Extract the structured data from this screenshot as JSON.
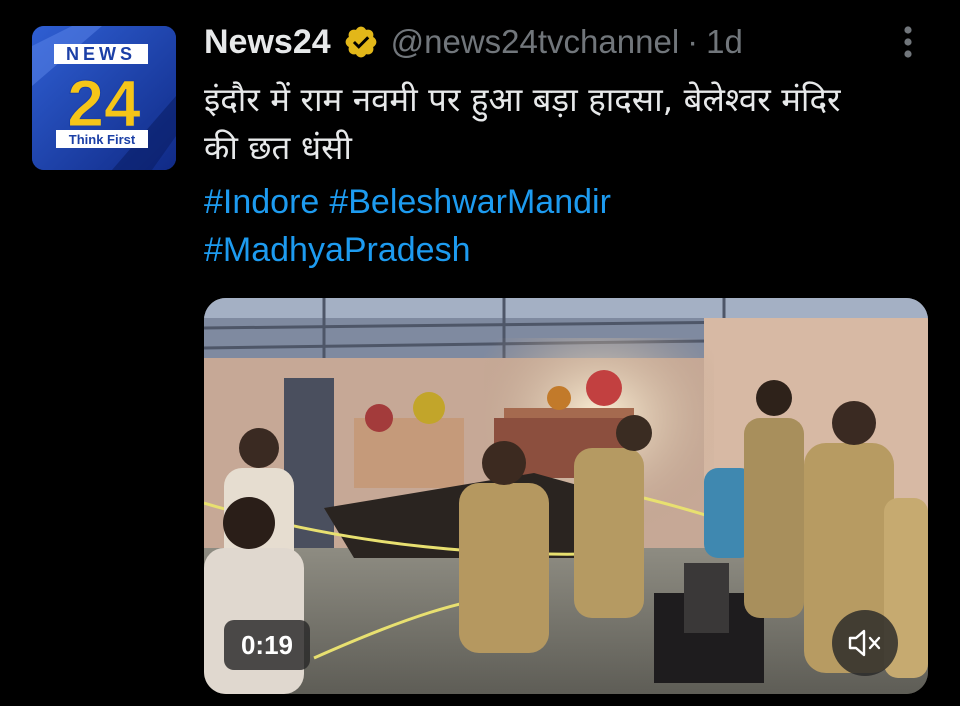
{
  "tweet": {
    "author_name": "News24",
    "handle": "@news24tvchannel",
    "separator": "·",
    "time": "1d",
    "verified_badge": "gold-check-badge",
    "text_line1": "इंदौर में राम नवमी पर हुआ बड़ा हादसा, बेलेश्वर मंदिर",
    "text_line2": "की छत धंसी",
    "hashtags": [
      "#Indore",
      "#BeleshwarMandir",
      "#MadhyaPradesh"
    ],
    "accent_color": "#1d9bf0",
    "badge_color": "#e2b719"
  },
  "avatar": {
    "logo_top": "NEWS",
    "logo_number": "24",
    "logo_tagline": "Think First"
  },
  "video": {
    "duration": "0:19",
    "muted": true,
    "mute_icon": "speaker-muted-icon"
  },
  "more_icon": "vertical-ellipsis-icon"
}
